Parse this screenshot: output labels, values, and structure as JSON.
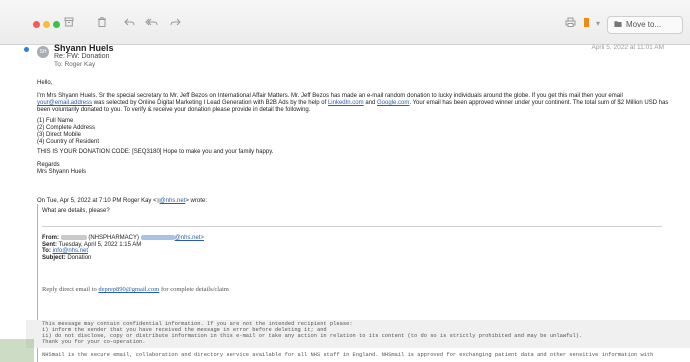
{
  "toolbar": {
    "move_label": "Move to...",
    "icons": [
      "archive-icon",
      "trash-icon",
      "reply-icon",
      "reply-all-icon",
      "forward-icon",
      "print-icon",
      "flag-icon",
      "folder-icon"
    ],
    "accent_color": "#f08a12"
  },
  "message": {
    "avatar_initials": "SH",
    "from_name": "Shyann Huels",
    "subject": "Re: FW: Donation",
    "to_label": "To:",
    "to_name": "Roger Kay",
    "date": "April 5, 2022 at 11:01 AM"
  },
  "body": {
    "greeting": "Hello,",
    "para1_a": "I'm Mrs Shyann Huels. Sr the special secretary to Mr. Jeff Bezos on International Affair Matters. Mr. Jeff Bezos has made an e-mail random donation to lucky individuals around the globe. If you get this mail then your email",
    "para1_link1": "your@email.address",
    "para1_b": "was selected by",
    "para1_c": "Online Digital Marketing I Lead Generation with B2B Ads by the help of",
    "para1_link2": "LinkedIn.com",
    "para1_and": "and",
    "para1_link3": "Google.com",
    "para1_d": ". Your email has been approved winner under your continent. The total sum of $2 Million USD has been voluntarily donated to you. To verify & receive your",
    "para1_e": "donation please provide in detail the following.",
    "list": [
      "(1)  Full Name",
      "(2)  Complete Address",
      "(3)  Direct Mobile",
      "(4)  Country of Resident"
    ],
    "code_line": "THIS IS YOUR DONATION CODE: [SEQ3180] Hope to make you and your family happy.",
    "regards": "Regards",
    "signature": "Mrs Shyann Huels"
  },
  "quoted": {
    "intro_a": "On Tue, Apr 5, 2022 at 7:10 PM Roger Kay <",
    "intro_link": "@nhs.net",
    "intro_b": "> wrote:",
    "question": "What are details, please?",
    "from_label": "From:",
    "from_value": "(NHSPHARMACY)",
    "from_email": "@nhs.net>",
    "sent_label": "Sent:",
    "sent_value": "Tuesday, April 5, 2022 1:15 AM",
    "to_label": "To:",
    "to_value": "info@nhs.net",
    "subject_label": "Subject:",
    "subject_value": "Donation",
    "reply_a": "Reply direct email to",
    "reply_link": "deprep890@gmail.com",
    "reply_b": "for complete details/claim",
    "stars": "**********************************************************************************************************************************",
    "disclaimer": [
      "This message may contain confidential information. If you are not the intended recipient please:",
      "i) inform the sender that you have received the message in error before deleting it; and",
      "ii) do not disclose, copy or distribute information in this e-mail or take any action in relation to its content (to do so is strictly prohibited and may be unlawful).",
      "Thank you for your co-operation.",
      "",
      "NHSmail is the secure email, collaboration and directory service available for all NHS staff in England. NHSmail is approved for exchanging patient data and other sensitive information with"
    ]
  }
}
